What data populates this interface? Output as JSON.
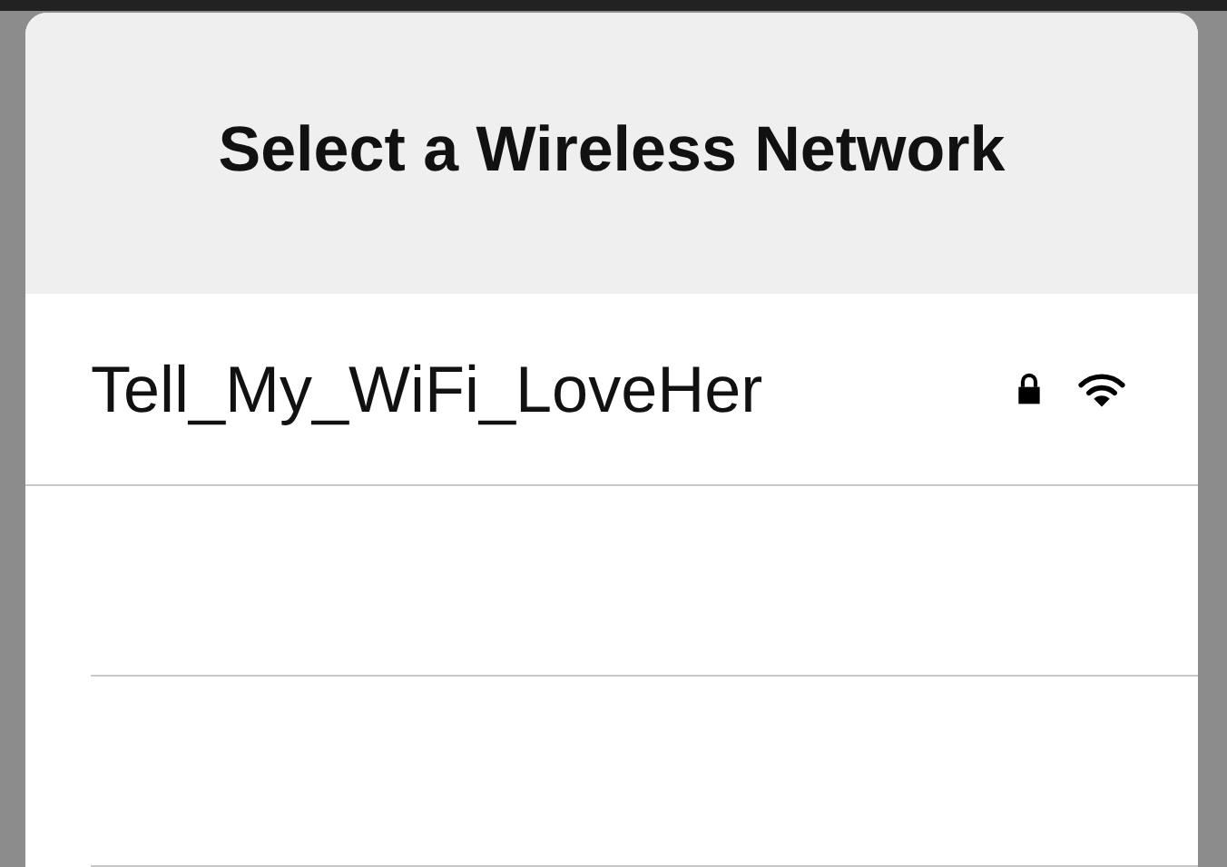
{
  "popover": {
    "title": "Select a Wireless Network"
  },
  "networks": [
    {
      "name": "Tell_My_WiFi_LoveHer",
      "secured": true
    }
  ]
}
